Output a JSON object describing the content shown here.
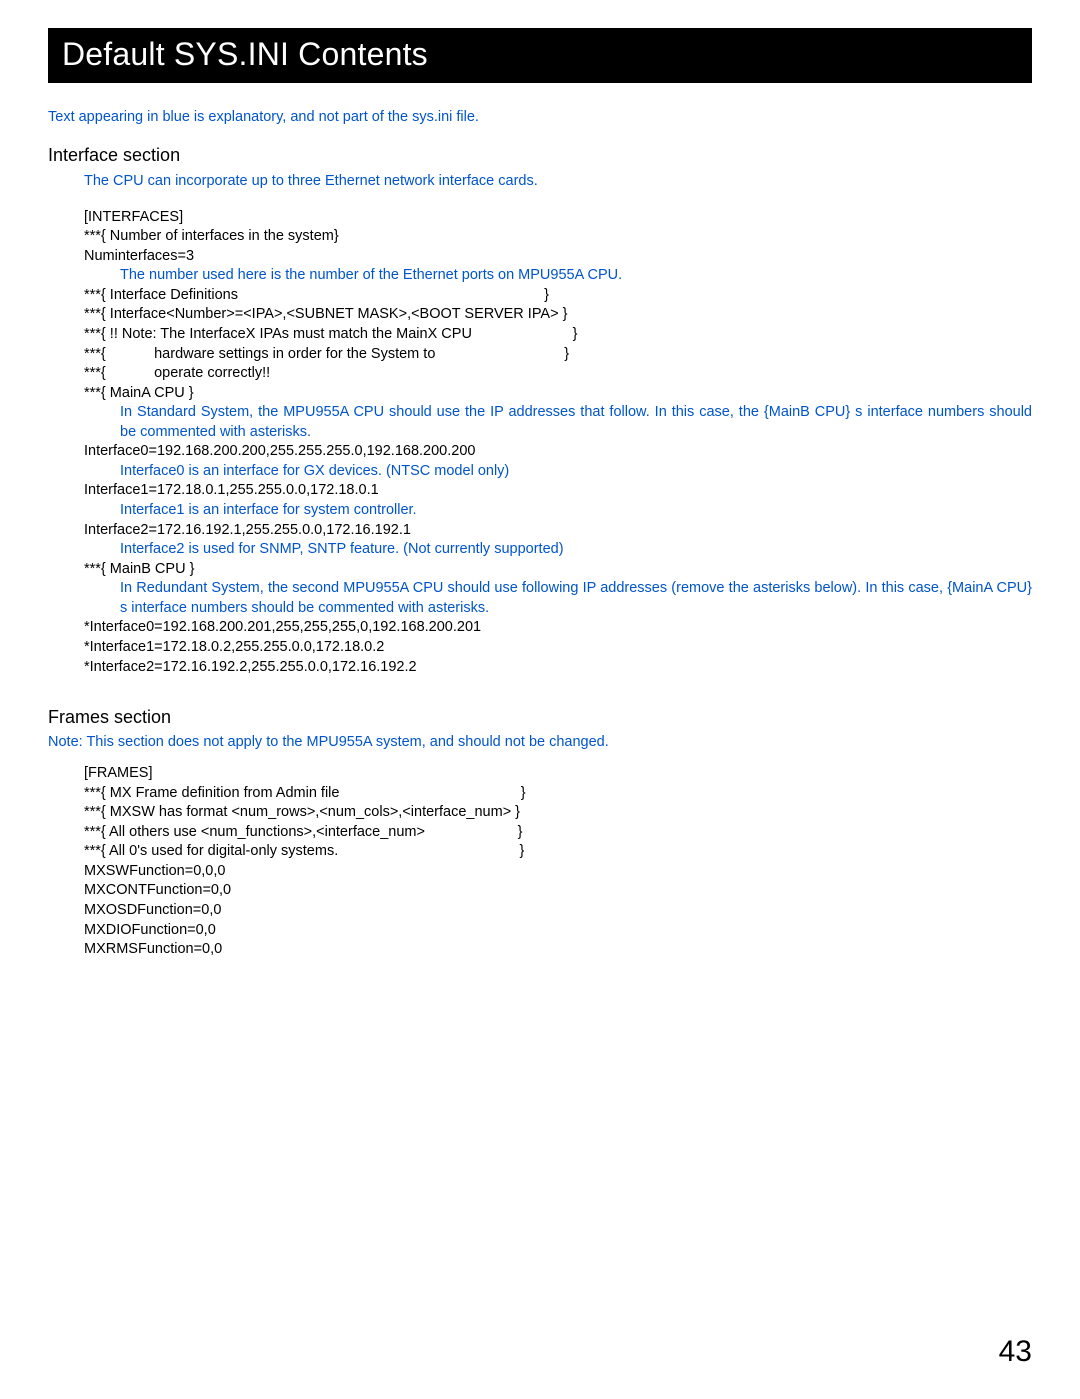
{
  "title": "Default SYS.INI Contents",
  "intro_note": "Text appearing in blue is explanatory, and not part of the sys.ini file.",
  "interface_section": {
    "heading": "Interface section",
    "cpu_note": "The CPU can incorporate up to three Ethernet network interface cards.",
    "l_interfaces": "[INTERFACES]",
    "l_numif_comment": "***{ Number of interfaces in the system}",
    "l_numif": "Numinterfaces=3",
    "l_numused_note": "The number used here is the number of the Ethernet ports on MPU955A CPU.",
    "l_ifdef": "***{ Interface Definitions                                                                            }",
    "l_ifnum": "***{ Interface<Number>=<IPA>,<SUBNET MASK>,<BOOT SERVER IPA> }",
    "l_note1": "***{ !! Note: The InterfaceX IPAs must match the MainX CPU                         }",
    "l_note2": "***{            hardware settings in order for the System to                                }",
    "l_note3": "***{            operate correctly!!",
    "l_maina": "***{ MainA CPU }",
    "l_maina_note": "In Standard System, the MPU955A CPU should use the IP addresses that follow. In this case, the {MainB CPU} s interface numbers should be commented with asterisks.",
    "l_if0": "Interface0=192.168.200.200,255.255.255.0,192.168.200.200",
    "l_if0_note": "Interface0 is an interface for GX devices. (NTSC model only)",
    "l_if1": "Interface1=172.18.0.1,255.255.0.0,172.18.0.1",
    "l_if1_note": "Interface1 is an interface for system controller.",
    "l_if2": "Interface2=172.16.192.1,255.255.0.0,172.16.192.1",
    "l_if2_note": "Interface2 is used for SNMP, SNTP feature. (Not currently supported)",
    "l_mainb": "***{ MainB CPU }",
    "l_mainb_note": "In Redundant System, the second MPU955A CPU should use following IP addresses (remove the asterisks below). In this case, {MainA CPU} s interface numbers should be commented with asterisks.",
    "l_bif0": "*Interface0=192.168.200.201,255,255,255,0,192.168.200.201",
    "l_bif1": "*Interface1=172.18.0.2,255.255.0.0,172.18.0.2",
    "l_bif2": "*Interface2=172.16.192.2,255.255.0.0,172.16.192.2"
  },
  "frames_section": {
    "heading": "Frames section",
    "note_label": "Note:",
    "note_text": "This section does not apply to the MPU955A system, and should not be changed.",
    "l_frames": "[FRAMES]",
    "l_mxframe": "***{ MX Frame definition from Admin file                                             }",
    "l_mxsw": "***{ MXSW has format <num_rows>,<num_cols>,<interface_num> }",
    "l_allothers": "***{ All others use <num_functions>,<interface_num>                       }",
    "l_all0": "***{ All 0's used for digital-only systems.                                             }",
    "l_mxswf": "MXSWFunction=0,0,0",
    "l_mxcont": "MXCONTFunction=0,0",
    "l_mxosd": "MXOSDFunction=0,0",
    "l_mxdio": "MXDIOFunction=0,0",
    "l_mxrms": "MXRMSFunction=0,0"
  },
  "page_number": "43"
}
